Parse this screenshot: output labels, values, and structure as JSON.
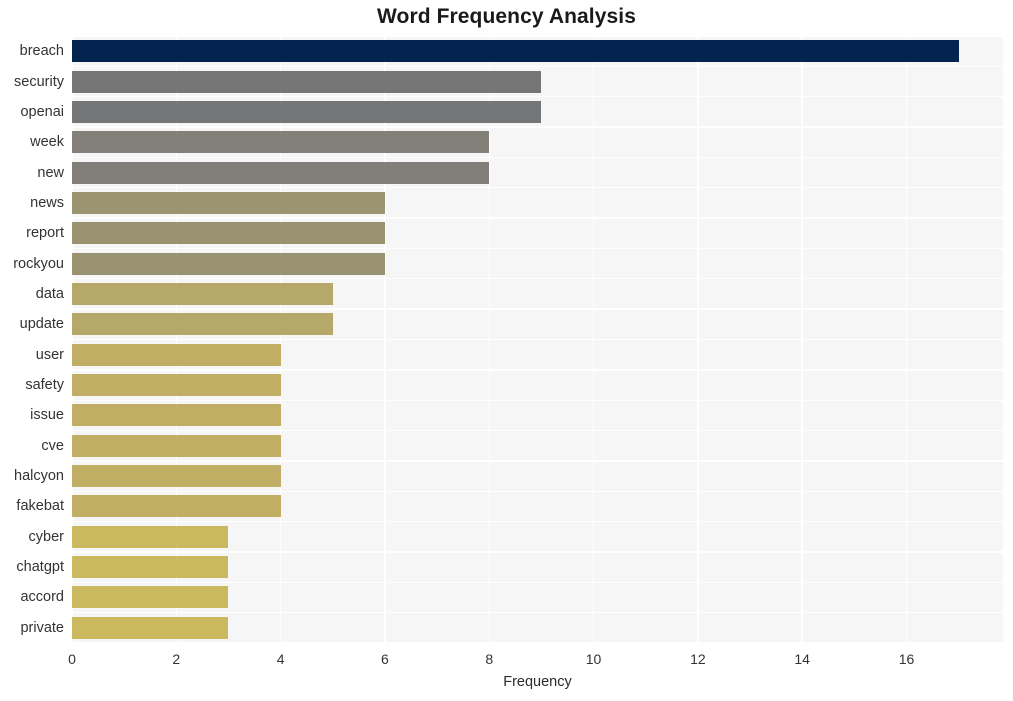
{
  "chart_data": {
    "type": "bar",
    "orientation": "horizontal",
    "title": "Word Frequency Analysis",
    "xlabel": "Frequency",
    "ylabel": "",
    "categories": [
      "breach",
      "security",
      "openai",
      "week",
      "new",
      "news",
      "report",
      "rockyou",
      "data",
      "update",
      "user",
      "safety",
      "issue",
      "cve",
      "halcyon",
      "fakebat",
      "cyber",
      "chatgpt",
      "accord",
      "private"
    ],
    "values": [
      17,
      9,
      9,
      8,
      8,
      6,
      6,
      6,
      5,
      5,
      4,
      4,
      4,
      4,
      4,
      4,
      3,
      3,
      3,
      3
    ],
    "bar_colors": [
      "#042450",
      "#767677",
      "#757677",
      "#828079",
      "#827f7a",
      "#9b9471",
      "#9a9371",
      "#9a9371",
      "#b5a868",
      "#b5a868",
      "#bfae63",
      "#bfae63",
      "#bfae63",
      "#bfae63",
      "#bfae63",
      "#bfae63",
      "#cbb95f",
      "#cbb95f",
      "#cbb95f",
      "#cbb95f"
    ],
    "xticks": [
      0,
      2,
      4,
      6,
      8,
      10,
      12,
      14,
      16
    ],
    "xtick_labels": [
      "0",
      "2",
      "4",
      "6",
      "8",
      "10",
      "12",
      "14",
      "16"
    ],
    "xlim": [
      0,
      17.85
    ],
    "grid": true,
    "grid_color": "#ffffff",
    "plot_background": "#f6f6f7",
    "figure_background": "#ffffff",
    "legend": null
  }
}
